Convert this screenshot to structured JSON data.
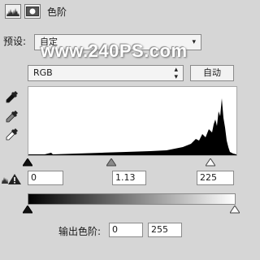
{
  "header": {
    "title": "色阶",
    "icons": [
      "histogram-icon",
      "mask-icon"
    ]
  },
  "preset": {
    "label": "预设:",
    "value": "自定"
  },
  "watermark": "www.240PS.com",
  "channel": {
    "value": "RGB"
  },
  "auto_button": "自动",
  "tools": [
    "black-point-eyedropper-icon",
    "gray-point-eyedropper-icon",
    "white-point-eyedropper-icon"
  ],
  "input_levels": {
    "black": "0",
    "gamma": "1.13",
    "white": "225"
  },
  "output_levels": {
    "label": "输出色阶:",
    "black": "0",
    "white": "255"
  },
  "colors": {
    "panel_bg": "#d6d6d6",
    "histogram_fill": "#000000"
  }
}
